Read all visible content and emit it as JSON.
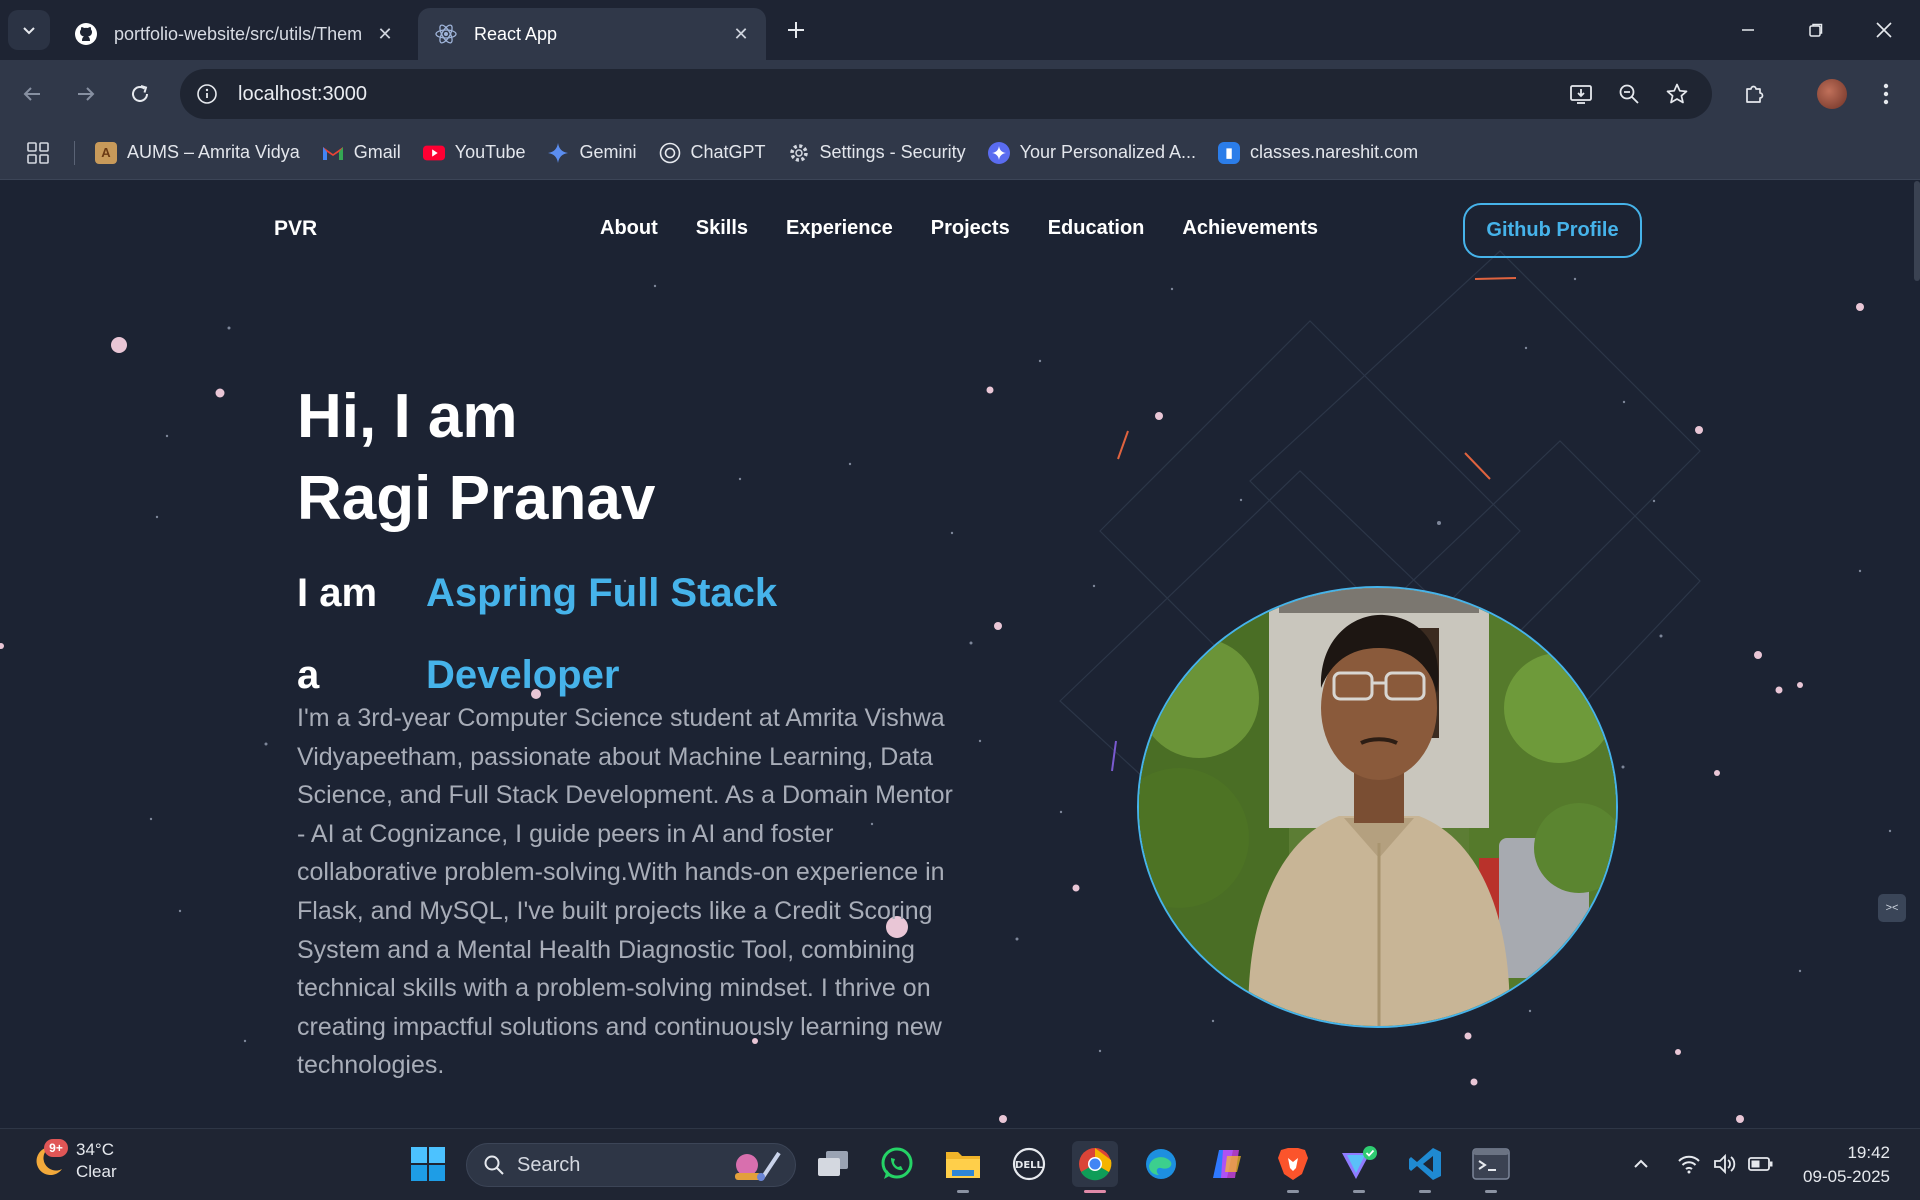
{
  "browser": {
    "tabs": [
      {
        "title": "portfolio-website/src/utils/Them",
        "icon": "github-icon",
        "active": false
      },
      {
        "title": "React App",
        "icon": "react-icon",
        "active": true
      }
    ],
    "url": "localhost:3000",
    "bookmarks": [
      {
        "label": "AUMS – Amrita Vidya",
        "icon": "aums-icon"
      },
      {
        "label": "Gmail",
        "icon": "gmail-icon"
      },
      {
        "label": "YouTube",
        "icon": "youtube-icon"
      },
      {
        "label": "Gemini",
        "icon": "gemini-icon"
      },
      {
        "label": "ChatGPT",
        "icon": "chatgpt-icon"
      },
      {
        "label": "Settings - Security",
        "icon": "gear-icon"
      },
      {
        "label": "Your Personalized A...",
        "icon": "personalized-icon"
      },
      {
        "label": "classes.nareshit.com",
        "icon": "nareshit-icon"
      }
    ]
  },
  "site": {
    "logo": "PVR",
    "nav": [
      "About",
      "Skills",
      "Experience",
      "Projects",
      "Education",
      "Achievements"
    ],
    "github_button": "Github Profile",
    "hero": {
      "greeting": "Hi, I am",
      "name": "Ragi Pranav",
      "iam": "I am a",
      "role": "Aspring Full Stack Developer",
      "description": "I'm a 3rd-year Computer Science student at Amrita Vishwa Vidyapeetham, passionate about Machine Learning, Data Science, and Full Stack Development. As a Domain Mentor - AI at Cognizance, I guide peers in AI and foster collaborative problem-solving.With hands-on experience in Flask, and MySQL, I've built projects like a Credit Scoring System and a Mental Health Diagnostic Tool, combining technical skills with a problem-solving mindset. I thrive on creating impactful solutions and continuously learning new technologies."
    },
    "colors": {
      "accent": "#46b3ea",
      "background": "#1c2333"
    }
  },
  "taskbar": {
    "weather": {
      "temp": "34°C",
      "condition": "Clear",
      "badge": "9+"
    },
    "search_label": "Search",
    "time": "19:42",
    "date": "09-05-2025"
  }
}
